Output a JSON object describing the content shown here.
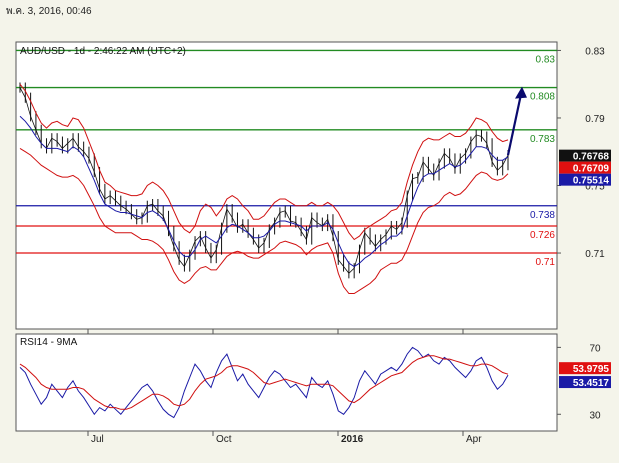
{
  "header": {
    "timestamp": "พ.ค. 3, 2016, 00:46"
  },
  "chart_data": [
    {
      "type": "line",
      "title": "AUD/USD - 1d - 2:46:22 AM (UTC+2)",
      "ylim": [
        0.665,
        0.835
      ],
      "y_ticks": [
        {
          "value": 0.83,
          "label": "0.83"
        },
        {
          "value": 0.79,
          "label": "0.79"
        },
        {
          "value": 0.75,
          "label": "0.75"
        },
        {
          "value": 0.71,
          "label": "0.71"
        }
      ],
      "x_ticks": [
        "Jul",
        "Oct",
        "2016",
        "Apr"
      ],
      "levels": [
        {
          "value": 0.83,
          "label": "0.83",
          "color": "#228b22"
        },
        {
          "value": 0.808,
          "label": "0.808",
          "color": "#228b22"
        },
        {
          "value": 0.783,
          "label": "0.783",
          "color": "#228b22"
        },
        {
          "value": 0.738,
          "label": "0.738",
          "color": "#1a1aa6"
        },
        {
          "value": 0.726,
          "label": "0.726",
          "color": "#e01010"
        },
        {
          "value": 0.71,
          "label": "0.71",
          "color": "#e01010"
        }
      ],
      "markers": [
        {
          "value": 0.76768,
          "label": "0.76768",
          "color": "#111111"
        },
        {
          "value": 0.76709,
          "label": "0.76709",
          "color": "#e01010"
        },
        {
          "value": 0.75514,
          "label": "0.75514",
          "color": "#1a1aa6"
        }
      ],
      "price": [
        0.808,
        0.802,
        0.791,
        0.783,
        0.775,
        0.772,
        0.778,
        0.776,
        0.772,
        0.775,
        0.778,
        0.773,
        0.77,
        0.766,
        0.758,
        0.748,
        0.742,
        0.744,
        0.741,
        0.738,
        0.736,
        0.733,
        0.73,
        0.731,
        0.738,
        0.739,
        0.735,
        0.732,
        0.723,
        0.714,
        0.706,
        0.702,
        0.709,
        0.717,
        0.72,
        0.713,
        0.707,
        0.712,
        0.725,
        0.736,
        0.731,
        0.725,
        0.727,
        0.722,
        0.718,
        0.713,
        0.716,
        0.724,
        0.728,
        0.734,
        0.735,
        0.729,
        0.728,
        0.723,
        0.718,
        0.731,
        0.728,
        0.726,
        0.73,
        0.72,
        0.706,
        0.702,
        0.698,
        0.701,
        0.712,
        0.722,
        0.718,
        0.714,
        0.718,
        0.721,
        0.726,
        0.724,
        0.728,
        0.744,
        0.754,
        0.755,
        0.764,
        0.76,
        0.756,
        0.763,
        0.769,
        0.766,
        0.76,
        0.766,
        0.769,
        0.776,
        0.78,
        0.779,
        0.775,
        0.764,
        0.759,
        0.762,
        0.768
      ],
      "bollinger_upper": [
        0.81,
        0.806,
        0.8,
        0.793,
        0.787,
        0.784,
        0.787,
        0.788,
        0.786,
        0.785,
        0.79,
        0.789,
        0.784,
        0.776,
        0.768,
        0.759,
        0.752,
        0.75,
        0.747,
        0.746,
        0.745,
        0.744,
        0.744,
        0.745,
        0.75,
        0.752,
        0.75,
        0.747,
        0.742,
        0.735,
        0.728,
        0.724,
        0.722,
        0.726,
        0.735,
        0.739,
        0.737,
        0.732,
        0.736,
        0.742,
        0.744,
        0.742,
        0.738,
        0.735,
        0.73,
        0.73,
        0.732,
        0.736,
        0.74,
        0.742,
        0.742,
        0.74,
        0.738,
        0.738,
        0.738,
        0.74,
        0.738,
        0.738,
        0.74,
        0.738,
        0.734,
        0.728,
        0.722,
        0.718,
        0.72,
        0.724,
        0.726,
        0.728,
        0.73,
        0.732,
        0.735,
        0.736,
        0.74,
        0.752,
        0.762,
        0.77,
        0.776,
        0.778,
        0.777,
        0.777,
        0.779,
        0.781,
        0.779,
        0.779,
        0.781,
        0.785,
        0.79,
        0.789,
        0.787,
        0.782,
        0.778,
        0.776,
        0.777
      ],
      "bollinger_lower": [
        0.772,
        0.77,
        0.768,
        0.765,
        0.762,
        0.76,
        0.758,
        0.756,
        0.755,
        0.755,
        0.756,
        0.754,
        0.75,
        0.744,
        0.738,
        0.731,
        0.726,
        0.724,
        0.722,
        0.722,
        0.722,
        0.722,
        0.72,
        0.718,
        0.718,
        0.717,
        0.715,
        0.712,
        0.706,
        0.699,
        0.694,
        0.692,
        0.694,
        0.698,
        0.701,
        0.702,
        0.7,
        0.7,
        0.704,
        0.708,
        0.71,
        0.711,
        0.71,
        0.708,
        0.707,
        0.707,
        0.709,
        0.711,
        0.713,
        0.716,
        0.717,
        0.716,
        0.715,
        0.713,
        0.709,
        0.712,
        0.714,
        0.715,
        0.716,
        0.71,
        0.698,
        0.69,
        0.686,
        0.686,
        0.688,
        0.69,
        0.692,
        0.695,
        0.7,
        0.702,
        0.704,
        0.704,
        0.706,
        0.712,
        0.72,
        0.728,
        0.734,
        0.737,
        0.738,
        0.74,
        0.744,
        0.746,
        0.744,
        0.745,
        0.748,
        0.752,
        0.756,
        0.758,
        0.757,
        0.754,
        0.753,
        0.754,
        0.757
      ],
      "moving_average": [
        0.791,
        0.788,
        0.784,
        0.779,
        0.775,
        0.772,
        0.772,
        0.772,
        0.771,
        0.77,
        0.773,
        0.771,
        0.767,
        0.76,
        0.753,
        0.745,
        0.739,
        0.737,
        0.735,
        0.734,
        0.734,
        0.733,
        0.732,
        0.731,
        0.734,
        0.735,
        0.733,
        0.73,
        0.724,
        0.717,
        0.711,
        0.708,
        0.708,
        0.712,
        0.718,
        0.72,
        0.718,
        0.716,
        0.72,
        0.725,
        0.727,
        0.726,
        0.724,
        0.722,
        0.719,
        0.719,
        0.72,
        0.723,
        0.727,
        0.729,
        0.729,
        0.728,
        0.727,
        0.726,
        0.723,
        0.726,
        0.726,
        0.726,
        0.728,
        0.724,
        0.716,
        0.709,
        0.704,
        0.702,
        0.704,
        0.707,
        0.709,
        0.712,
        0.715,
        0.717,
        0.72,
        0.72,
        0.723,
        0.732,
        0.741,
        0.749,
        0.755,
        0.757,
        0.757,
        0.759,
        0.761,
        0.763,
        0.761,
        0.762,
        0.765,
        0.769,
        0.773,
        0.773,
        0.772,
        0.768,
        0.765,
        0.765,
        0.767
      ]
    },
    {
      "type": "line",
      "title": "RSI14 - 9MA",
      "ylim": [
        20,
        78
      ],
      "y_ticks": [
        {
          "value": 70,
          "label": "70"
        },
        {
          "value": 30,
          "label": "30"
        }
      ],
      "markers": [
        {
          "value": 53.9795,
          "label": "53.9795",
          "color": "#e01010"
        },
        {
          "value": 53.4517,
          "label": "53.4517",
          "color": "#1a1aa6"
        }
      ],
      "rsi": [
        58,
        55,
        48,
        42,
        36,
        40,
        48,
        44,
        40,
        46,
        50,
        44,
        40,
        35,
        30,
        34,
        32,
        36,
        33,
        30,
        34,
        38,
        42,
        46,
        48,
        44,
        38,
        33,
        30,
        28,
        34,
        44,
        52,
        60,
        56,
        50,
        46,
        55,
        62,
        66,
        58,
        50,
        54,
        48,
        44,
        40,
        46,
        52,
        56,
        54,
        50,
        46,
        48,
        44,
        40,
        52,
        48,
        46,
        50,
        42,
        32,
        30,
        34,
        40,
        50,
        56,
        52,
        48,
        54,
        56,
        58,
        56,
        60,
        66,
        70,
        68,
        64,
        66,
        62,
        60,
        64,
        62,
        58,
        55,
        52,
        56,
        62,
        64,
        58,
        50,
        45,
        48,
        53.45
      ],
      "rsi_ma": [
        60,
        58,
        55,
        52,
        48,
        46,
        45,
        45,
        45,
        45,
        46,
        46,
        45,
        42,
        39,
        37,
        35,
        34,
        34,
        33,
        33,
        34,
        36,
        38,
        40,
        42,
        42,
        41,
        39,
        36,
        35,
        36,
        39,
        44,
        48,
        51,
        52,
        53,
        55,
        58,
        59,
        59,
        58,
        57,
        55,
        52,
        49,
        48,
        49,
        50,
        51,
        50,
        49,
        48,
        47,
        48,
        48,
        48,
        48,
        47,
        44,
        41,
        38,
        37,
        39,
        42,
        45,
        47,
        49,
        51,
        53,
        54,
        55,
        58,
        61,
        63,
        64,
        65,
        65,
        64,
        63,
        63,
        62,
        61,
        60,
        59,
        59,
        60,
        60,
        59,
        57,
        55,
        53.98
      ]
    }
  ]
}
